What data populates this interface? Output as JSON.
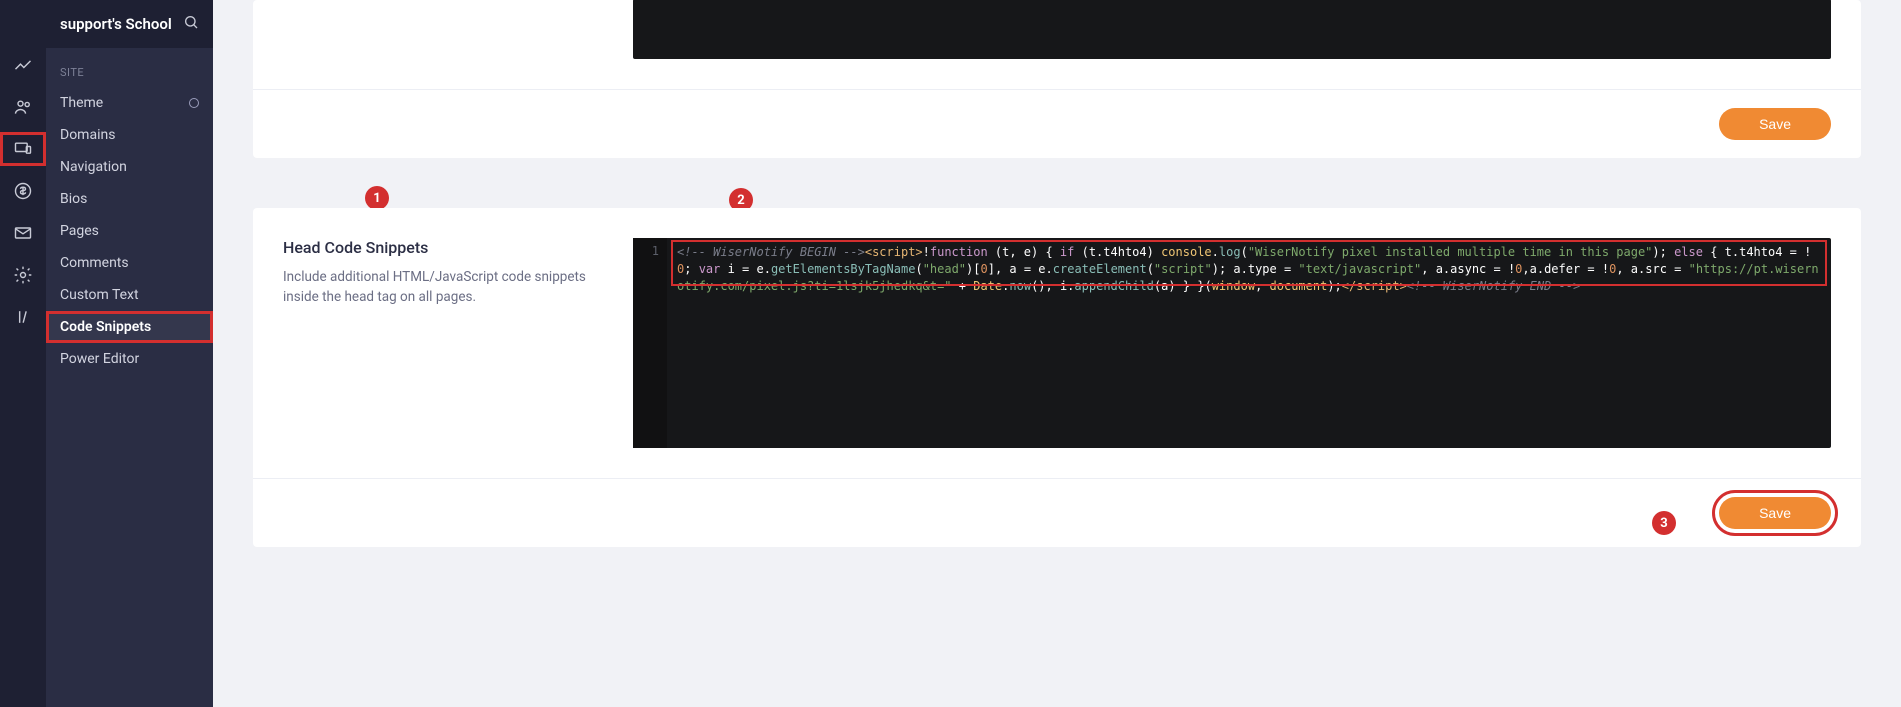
{
  "app": {
    "title": "support's School"
  },
  "rail_icons": [
    "chart-line",
    "people",
    "devices",
    "currency",
    "mail",
    "gear",
    "lines"
  ],
  "rail_active_index": 2,
  "sidebar": {
    "section_label": "SITE",
    "items": [
      {
        "label": "Theme",
        "has_ring": true
      },
      {
        "label": "Domains"
      },
      {
        "label": "Navigation"
      },
      {
        "label": "Bios"
      },
      {
        "label": "Pages"
      },
      {
        "label": "Comments"
      },
      {
        "label": "Custom Text"
      },
      {
        "label": "Code Snippets",
        "active": true
      },
      {
        "label": "Power Editor"
      }
    ]
  },
  "annotations": {
    "badge1": "1",
    "badge2": "2",
    "badge3": "3"
  },
  "upper_card": {
    "save_label": "Save"
  },
  "head_card": {
    "title": "Head Code Snippets",
    "description": "Include additional HTML/JavaScript code snippets inside the head tag on all pages.",
    "line_number": "1",
    "save_label": "Save",
    "code_tokens": [
      {
        "t": "<!-- WiserNotify BEGIN -->",
        "c": "cmt"
      },
      {
        "t": "<script>",
        "c": "tag"
      },
      {
        "t": "!",
        "c": "pl"
      },
      {
        "t": "function",
        "c": "kw"
      },
      {
        "t": " (t, e) { ",
        "c": "pl"
      },
      {
        "t": "if",
        "c": "kw"
      },
      {
        "t": " (t.t4hto4) ",
        "c": "pl"
      },
      {
        "t": "console",
        "c": "id"
      },
      {
        "t": ".",
        "c": "pl"
      },
      {
        "t": "log",
        "c": "fn"
      },
      {
        "t": "(",
        "c": "pl"
      },
      {
        "t": "\"WiserNotify pixel installed multiple time in this page\"",
        "c": "str"
      },
      {
        "t": "); ",
        "c": "pl"
      },
      {
        "t": "else",
        "c": "kw"
      },
      {
        "t": " { t.t4hto4 = !",
        "c": "pl"
      },
      {
        "t": "0",
        "c": "num"
      },
      {
        "t": "; ",
        "c": "pl"
      },
      {
        "t": "var",
        "c": "kw"
      },
      {
        "t": " i = e.",
        "c": "pl"
      },
      {
        "t": "getElementsByTagName",
        "c": "fn"
      },
      {
        "t": "(",
        "c": "pl"
      },
      {
        "t": "\"head\"",
        "c": "str"
      },
      {
        "t": ")[",
        "c": "pl"
      },
      {
        "t": "0",
        "c": "num"
      },
      {
        "t": "], a = e.",
        "c": "pl"
      },
      {
        "t": "createElement",
        "c": "fn"
      },
      {
        "t": "(",
        "c": "pl"
      },
      {
        "t": "\"script\"",
        "c": "str"
      },
      {
        "t": "); a.type = ",
        "c": "pl"
      },
      {
        "t": "\"text/javascript\"",
        "c": "str"
      },
      {
        "t": ", a.async = !",
        "c": "pl"
      },
      {
        "t": "0",
        "c": "num"
      },
      {
        "t": ",a.defer = !",
        "c": "pl"
      },
      {
        "t": "0",
        "c": "num"
      },
      {
        "t": ", a.src = ",
        "c": "pl"
      },
      {
        "t": "\"https://pt.wisernotify.com/pixel.js?ti=1lsjk5jhedkq&t=\"",
        "c": "str"
      },
      {
        "t": " + ",
        "c": "pl"
      },
      {
        "t": "Date",
        "c": "id"
      },
      {
        "t": ".",
        "c": "pl"
      },
      {
        "t": "now",
        "c": "fn"
      },
      {
        "t": "(), i.",
        "c": "pl"
      },
      {
        "t": "appendChild",
        "c": "fn"
      },
      {
        "t": "(a) } }(",
        "c": "pl"
      },
      {
        "t": "window",
        "c": "id"
      },
      {
        "t": ", ",
        "c": "pl"
      },
      {
        "t": "document",
        "c": "id"
      },
      {
        "t": ");",
        "c": "pl"
      },
      {
        "t": "</script>",
        "c": "tag"
      },
      {
        "t": "<!-- WiserNotify END -->",
        "c": "cmt"
      }
    ]
  }
}
